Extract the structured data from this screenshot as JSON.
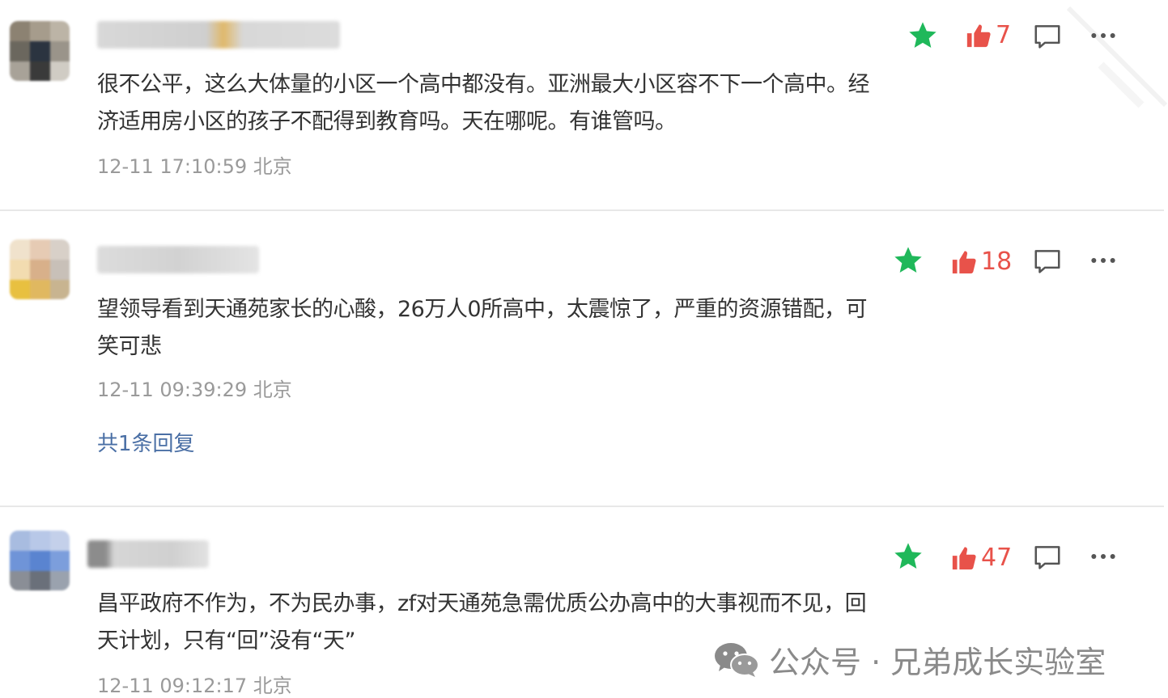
{
  "comments": [
    {
      "text": "很不公平，这么大体量的小区一个高中都没有。亚洲最大小区容不下一个高中。经济适用房小区的孩子不配得到教育吗。天在哪呢。有谁管吗。",
      "time": "12-11 17:10:59 北京",
      "likes": "7"
    },
    {
      "text": "望领导看到天通苑家长的心酸，26万人0所高中，太震惊了，严重的资源错配，可笑可悲",
      "time": "12-11 09:39:29 北京",
      "likes": "18",
      "reply_link": "共1条回复"
    },
    {
      "text": "昌平政府不作为，不为民办事，zf对天通苑急需优质公办高中的大事视而不见，回天计划，只有“回”没有“天”",
      "time": "12-11 09:12:17 北京",
      "likes": "47"
    }
  ],
  "icons": {
    "star": "star-icon",
    "like": "thumbs-up-icon",
    "reply": "comment-bubble-icon",
    "more": "more-dots-icon",
    "watermark": "wechat-icon"
  },
  "colors": {
    "star": "#1fb85a",
    "like": "#e8524a",
    "reply_link": "#4a6fa5",
    "time": "#9a9a9a"
  },
  "watermark": {
    "text": "公众号 · 兄弟成长实验室"
  }
}
